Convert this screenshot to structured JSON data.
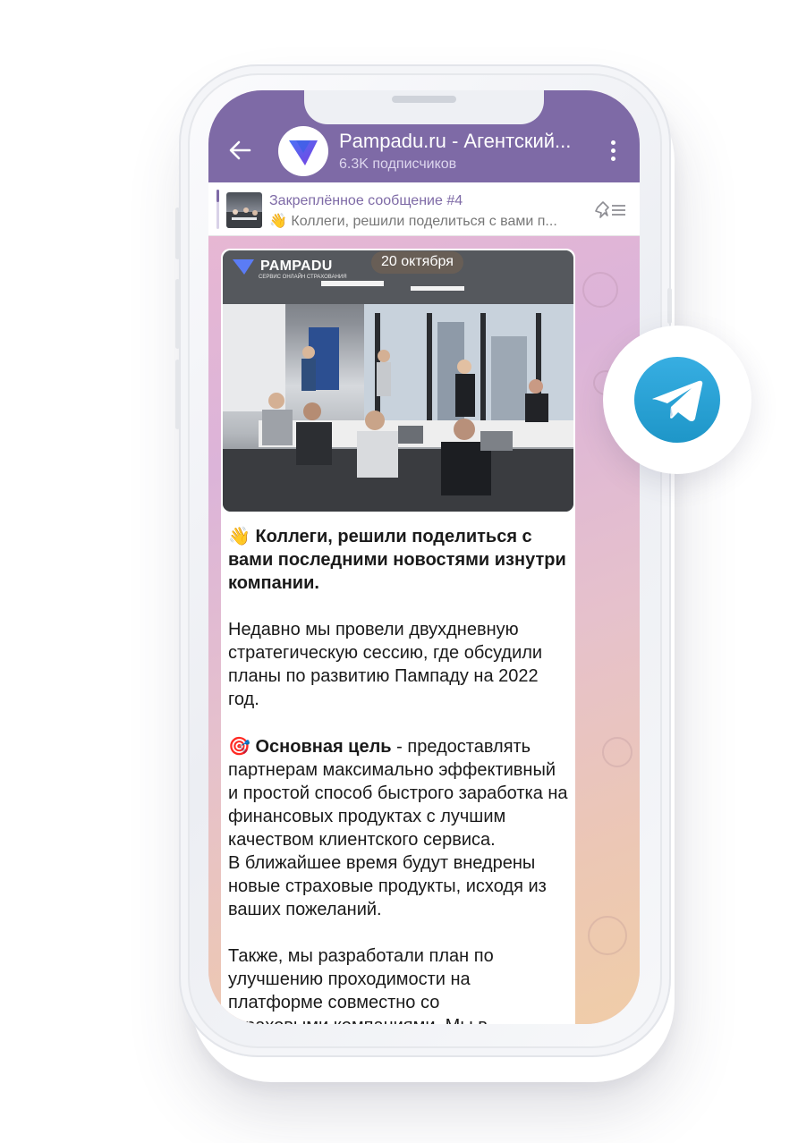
{
  "header": {
    "channel_title": "Pampadu.ru - Агентский...",
    "subscribers": "6.3K подписчиков"
  },
  "pinned": {
    "title": "Закреплённое сообщение #4",
    "text": "👋 Коллеги, решили поделиться с вами п..."
  },
  "message": {
    "date": "20 октября",
    "photo_brand": "PAMPADU",
    "photo_brand_sub": "СЕРВИС ОНЛАЙН СТРАХОВАНИЯ",
    "headline_emoji": "👋",
    "headline": "Коллеги, решили поделиться с вами последними новостями изнутри компании.",
    "paragraph1": "Недавно мы провели двухдневную стратегическую сессию, где обсудили планы по развитию Пампаду на 2022 год.",
    "goal_emoji": "🎯",
    "goal_label": "Основная цель",
    "goal_text": " - предоставлять партнерам максимально эффективный и простой способ быстрого заработка на финансовых продуктах с лучшим качеством клиентского сервиса.",
    "paragraph3": "В ближайшее время будут внедрены новые страховые продукты, исходя из ваших пожеланий.",
    "paragraph4": "Также, мы разработали план по улучшению проходимости на платформе совместно со страховыми компаниями. Мы в"
  },
  "colors": {
    "header": "#7e6aa6",
    "accent": "#7e6aa6",
    "telegram": "#2aa3e0"
  },
  "icons": [
    "back-arrow-icon",
    "channel-avatar-icon",
    "more-vertical-icon",
    "unpin-list-icon",
    "telegram-logo-icon"
  ]
}
